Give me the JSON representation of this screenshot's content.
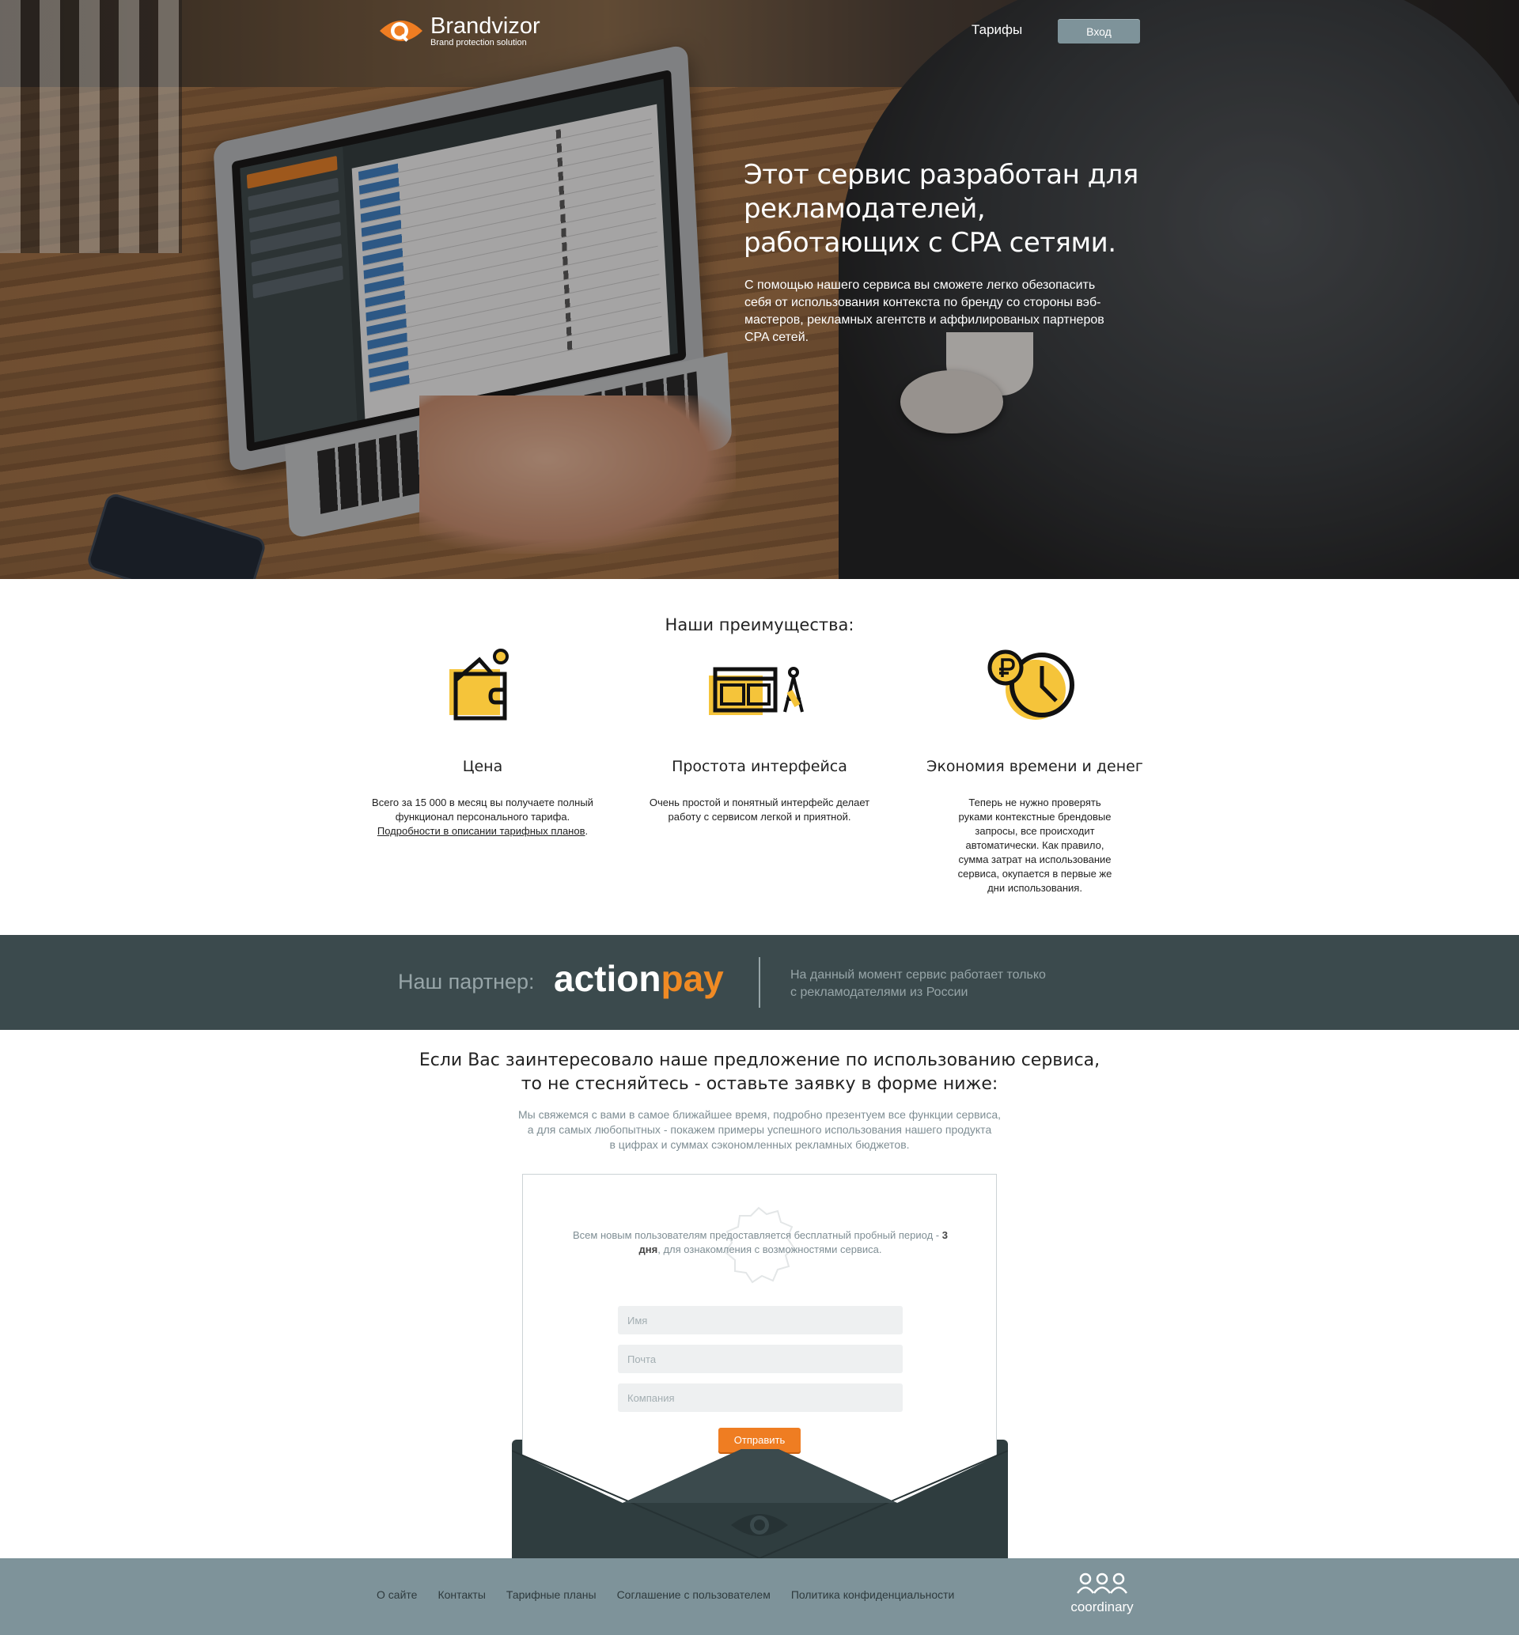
{
  "header": {
    "brand_name": "Brandvizor",
    "brand_tagline": "Brand protection solution",
    "nav_tariffs": "Тарифы",
    "login_label": "Вход"
  },
  "hero": {
    "title": "Этот сервис разработан для рекламодателей, работающих с CPA сетями.",
    "text": "С помощью нашего сервиса вы сможете легко обезопасить себя от использования контекста по бренду со стороны вэб-мастеров, рекламных агентств и аффилированых партнеров CPA сетей."
  },
  "advantages": {
    "title": "Наши преимущества:",
    "items": [
      {
        "icon": "wallet-icon",
        "head": "Цена",
        "text_before": "Всего  за 15 000 в месяц вы получаете полный функционал персонального тарифа. ",
        "link": "Подробности в описании тарифных планов",
        "text_after": "."
      },
      {
        "icon": "interface-icon",
        "head": "Простота интерфейса",
        "text": "Очень простой и понятный интерфейс делает работу с сервисом легкой и приятной."
      },
      {
        "icon": "time-money-icon",
        "head": "Экономия времени и денег",
        "text": "Теперь не нужно проверять руками контекстные брендовые запросы, все происходит автоматически. Как правило, сумма затрат на использование сервиса, окупается в первые же дни использования."
      }
    ]
  },
  "partner": {
    "label": "Наш партнер:",
    "logo_part1": "action",
    "logo_part2": "pay",
    "note": "На данный момент сервис работает только с рекламодателями из России"
  },
  "cta": {
    "title_line1": "Если Вас заинтересовало наше предложение по использованию сервиса,",
    "title_line2": "то не стесняйтесь - оставьте заявку в форме ниже:",
    "sub_line1": "Мы свяжемся с вами в самое ближайшее время, подробно презентуем все функции сервиса,",
    "sub_line2": "а для самых любопытных - покажем примеры успешного использования нашего продукта",
    "sub_line3": "в цифрах и суммах сэкономленных рекламных бюджетов."
  },
  "form": {
    "trial_before": "Всем новым пользователям предоставляется бесплатный пробный период - ",
    "trial_bold": "3 дня",
    "trial_after": ",  для ознакомления с возможностями сервиса.",
    "name_placeholder": "Имя",
    "email_placeholder": "Почта",
    "company_placeholder": "Компания",
    "submit_label": "Отправить"
  },
  "footer": {
    "links": [
      "О сайте",
      "Контакты",
      "Тарифные планы",
      "Соглашение с пользователем",
      "Политика конфиденциальности"
    ],
    "brand": "coordinary"
  },
  "colors": {
    "accent": "#ef7d22",
    "dark": "#3b4a4d",
    "footer": "#7e939a",
    "icon_yellow": "#f5c43a"
  }
}
